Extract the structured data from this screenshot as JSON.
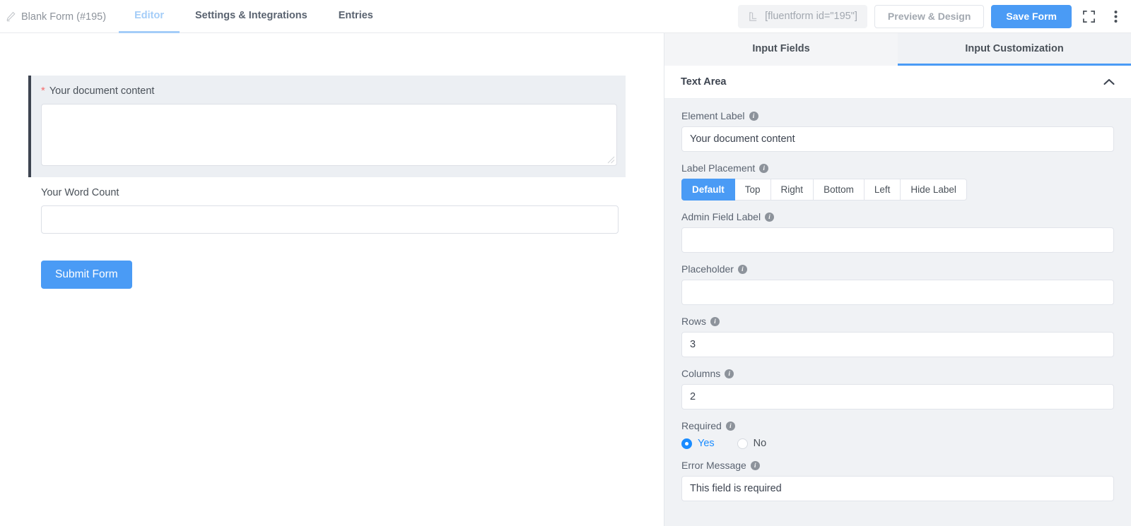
{
  "topbar": {
    "form_title": "Blank Form (#195)",
    "pencil_icon": "pencil-icon",
    "tabs": [
      {
        "label": "Editor",
        "active": true
      },
      {
        "label": "Settings & Integrations",
        "active": false
      },
      {
        "label": "Entries",
        "active": false
      }
    ],
    "shortcode": "[fluentform id=\"195\"]",
    "shortcode_icon": "shortcode-bracket-icon",
    "preview_label": "Preview & Design",
    "save_label": "Save Form",
    "fullscreen_icon": "fullscreen-icon",
    "more_icon": "more-vertical-icon"
  },
  "editor": {
    "fields": [
      {
        "label": "Your document content",
        "required": true,
        "required_marker": "*",
        "type": "textarea",
        "value": "",
        "selected": true
      },
      {
        "label": "Your Word Count",
        "required": false,
        "required_marker": "",
        "type": "text",
        "value": "",
        "selected": false
      }
    ],
    "submit_label": "Submit Form"
  },
  "panel": {
    "tabs": [
      {
        "label": "Input Fields",
        "active": false
      },
      {
        "label": "Input Customization",
        "active": true
      }
    ],
    "section_title": "Text Area",
    "collapse_icon": "chevron-up-icon",
    "settings": {
      "element_label": {
        "label": "Element Label",
        "value": "Your document content",
        "placeholder": ""
      },
      "label_placement": {
        "label": "Label Placement",
        "options": [
          "Default",
          "Top",
          "Right",
          "Bottom",
          "Left",
          "Hide Label"
        ],
        "selected": "Default"
      },
      "admin_field_label": {
        "label": "Admin Field Label",
        "value": "",
        "placeholder": ""
      },
      "placeholder_setting": {
        "label": "Placeholder",
        "value": "",
        "placeholder": ""
      },
      "rows": {
        "label": "Rows",
        "value": "3"
      },
      "columns": {
        "label": "Columns",
        "value": "2"
      },
      "required": {
        "label": "Required",
        "options": [
          "Yes",
          "No"
        ],
        "selected": "Yes"
      },
      "error_message": {
        "label": "Error Message",
        "value": "This field is required",
        "placeholder": ""
      }
    }
  },
  "colors": {
    "accent_blue": "#4a9bf5",
    "radio_blue": "#1a8cff",
    "tab_active_blue": "#a4cdf8",
    "required_red": "#f56c6c",
    "panel_bg": "#f0f2f5",
    "selected_field_bg": "#eceff3",
    "selected_field_border": "#3d4450"
  }
}
